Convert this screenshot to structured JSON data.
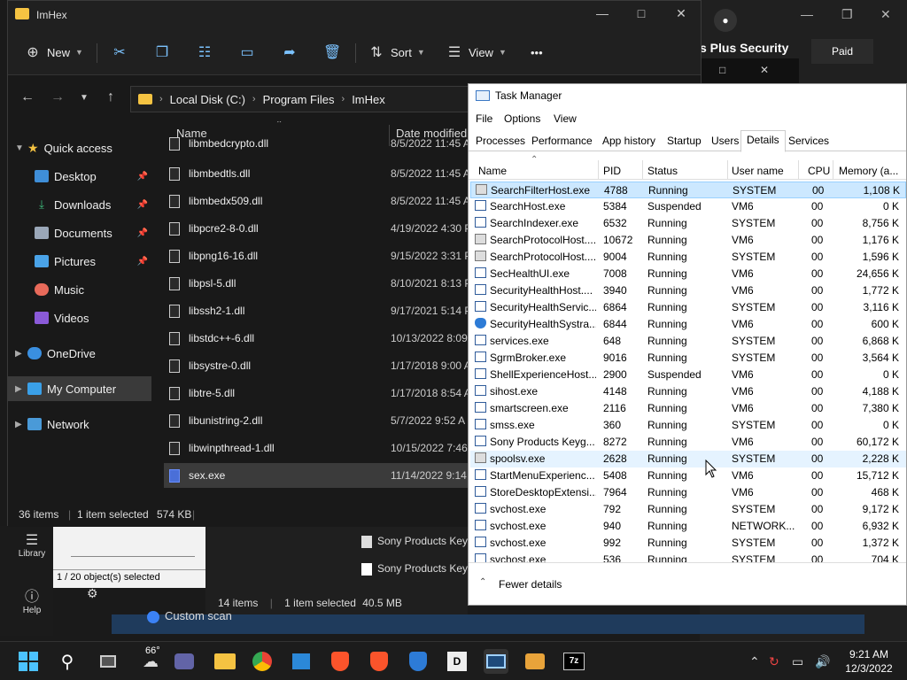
{
  "explorer": {
    "title": "ImHex",
    "toolbar": {
      "new": "New",
      "sort": "Sort",
      "view": "View",
      "more": "•••"
    },
    "breadcrumbs": [
      "Local Disk (C:)",
      "Program Files",
      "ImHex"
    ],
    "nav": {
      "quick_access": "Quick access",
      "desktop": "Desktop",
      "downloads": "Downloads",
      "documents": "Documents",
      "pictures": "Pictures",
      "music": "Music",
      "videos": "Videos",
      "onedrive": "OneDrive",
      "my_computer": "My Computer",
      "network": "Network"
    },
    "columns": {
      "name": "Name",
      "date": "Date modified"
    },
    "files": [
      {
        "name": "libmbedcrypto.dll",
        "date": "8/5/2022 11:45 A"
      },
      {
        "name": "libmbedtls.dll",
        "date": "8/5/2022 11:45 AM"
      },
      {
        "name": "libmbedx509.dll",
        "date": "8/5/2022 11:45 AM"
      },
      {
        "name": "libpcre2-8-0.dll",
        "date": "4/19/2022 4:30 P"
      },
      {
        "name": "libpng16-16.dll",
        "date": "9/15/2022 3:31 P"
      },
      {
        "name": "libpsl-5.dll",
        "date": "8/10/2021 8:13 P"
      },
      {
        "name": "libssh2-1.dll",
        "date": "9/17/2021 5:14 P"
      },
      {
        "name": "libstdc++-6.dll",
        "date": "10/13/2022 8:09"
      },
      {
        "name": "libsystre-0.dll",
        "date": "1/17/2018 9:00 A"
      },
      {
        "name": "libtre-5.dll",
        "date": "1/17/2018 8:54 A"
      },
      {
        "name": "libunistring-2.dll",
        "date": "5/7/2022 9:52 A"
      },
      {
        "name": "libwinpthread-1.dll",
        "date": "10/15/2022 7:46"
      },
      {
        "name": "sex.exe",
        "date": "11/14/2022 9:14"
      }
    ],
    "status": {
      "items": "36 items",
      "selected": "1 item selected",
      "size": "574 KB"
    }
  },
  "taskmanager": {
    "title": "Task Manager",
    "menu": [
      "File",
      "Options",
      "View"
    ],
    "tabs": [
      "Processes",
      "Performance",
      "App history",
      "Startup",
      "Users",
      "Details",
      "Services"
    ],
    "active_tab": "Details",
    "columns": {
      "name": "Name",
      "pid": "PID",
      "status": "Status",
      "user": "User name",
      "cpu": "CPU",
      "memory": "Memory (a..."
    },
    "rows": [
      {
        "name": "SearchFilterHost.exe",
        "pid": "4788",
        "status": "Running",
        "user": "SYSTEM",
        "cpu": "00",
        "mem": "1,108 K"
      },
      {
        "name": "SearchHost.exe",
        "pid": "5384",
        "status": "Suspended",
        "user": "VM6",
        "cpu": "00",
        "mem": "0 K"
      },
      {
        "name": "SearchIndexer.exe",
        "pid": "6532",
        "status": "Running",
        "user": "SYSTEM",
        "cpu": "00",
        "mem": "8,756 K"
      },
      {
        "name": "SearchProtocolHost....",
        "pid": "10672",
        "status": "Running",
        "user": "VM6",
        "cpu": "00",
        "mem": "1,176 K"
      },
      {
        "name": "SearchProtocolHost....",
        "pid": "9004",
        "status": "Running",
        "user": "SYSTEM",
        "cpu": "00",
        "mem": "1,596 K"
      },
      {
        "name": "SecHealthUI.exe",
        "pid": "7008",
        "status": "Running",
        "user": "VM6",
        "cpu": "00",
        "mem": "24,656 K"
      },
      {
        "name": "SecurityHealthHost....",
        "pid": "3940",
        "status": "Running",
        "user": "VM6",
        "cpu": "00",
        "mem": "1,772 K"
      },
      {
        "name": "SecurityHealthServic...",
        "pid": "6864",
        "status": "Running",
        "user": "SYSTEM",
        "cpu": "00",
        "mem": "3,116 K"
      },
      {
        "name": "SecurityHealthSystra...",
        "pid": "6844",
        "status": "Running",
        "user": "VM6",
        "cpu": "00",
        "mem": "600 K"
      },
      {
        "name": "services.exe",
        "pid": "648",
        "status": "Running",
        "user": "SYSTEM",
        "cpu": "00",
        "mem": "6,868 K"
      },
      {
        "name": "SgrmBroker.exe",
        "pid": "9016",
        "status": "Running",
        "user": "SYSTEM",
        "cpu": "00",
        "mem": "3,564 K"
      },
      {
        "name": "ShellExperienceHost....",
        "pid": "2900",
        "status": "Suspended",
        "user": "VM6",
        "cpu": "00",
        "mem": "0 K"
      },
      {
        "name": "sihost.exe",
        "pid": "4148",
        "status": "Running",
        "user": "VM6",
        "cpu": "00",
        "mem": "4,188 K"
      },
      {
        "name": "smartscreen.exe",
        "pid": "2116",
        "status": "Running",
        "user": "VM6",
        "cpu": "00",
        "mem": "7,380 K"
      },
      {
        "name": "smss.exe",
        "pid": "360",
        "status": "Running",
        "user": "SYSTEM",
        "cpu": "00",
        "mem": "0 K"
      },
      {
        "name": "Sony Products Keyg...",
        "pid": "8272",
        "status": "Running",
        "user": "VM6",
        "cpu": "00",
        "mem": "60,172 K"
      },
      {
        "name": "spoolsv.exe",
        "pid": "2628",
        "status": "Running",
        "user": "SYSTEM",
        "cpu": "00",
        "mem": "2,228 K"
      },
      {
        "name": "StartMenuExperienc...",
        "pid": "5408",
        "status": "Running",
        "user": "VM6",
        "cpu": "00",
        "mem": "15,712 K"
      },
      {
        "name": "StoreDesktopExtensi...",
        "pid": "7964",
        "status": "Running",
        "user": "VM6",
        "cpu": "00",
        "mem": "468 K"
      },
      {
        "name": "svchost.exe",
        "pid": "792",
        "status": "Running",
        "user": "SYSTEM",
        "cpu": "00",
        "mem": "9,172 K"
      },
      {
        "name": "svchost.exe",
        "pid": "940",
        "status": "Running",
        "user": "NETWORK...",
        "cpu": "00",
        "mem": "6,932 K"
      },
      {
        "name": "svchost.exe",
        "pid": "992",
        "status": "Running",
        "user": "SYSTEM",
        "cpu": "00",
        "mem": "1,372 K"
      },
      {
        "name": "svchost.exe",
        "pid": "536",
        "status": "Running",
        "user": "SYSTEM",
        "cpu": "00",
        "mem": "704 K"
      }
    ],
    "footer": "Fewer details"
  },
  "background": {
    "security_title": "s Plus Security",
    "paid": "Paid",
    "library": "Library",
    "help": "Help",
    "objects_selected": "1 / 20 object(s) selected",
    "exp2_items": "14 items",
    "exp2_selected": "1 item selected",
    "exp2_size": "40.5 MB",
    "exp2_file1": "Sony Products Key",
    "exp2_file2": "Sony Products Key",
    "custom_scan": "Custom scan"
  },
  "taskbar": {
    "weather": "66°",
    "time": "9:21 AM",
    "date": "12/3/2022"
  }
}
